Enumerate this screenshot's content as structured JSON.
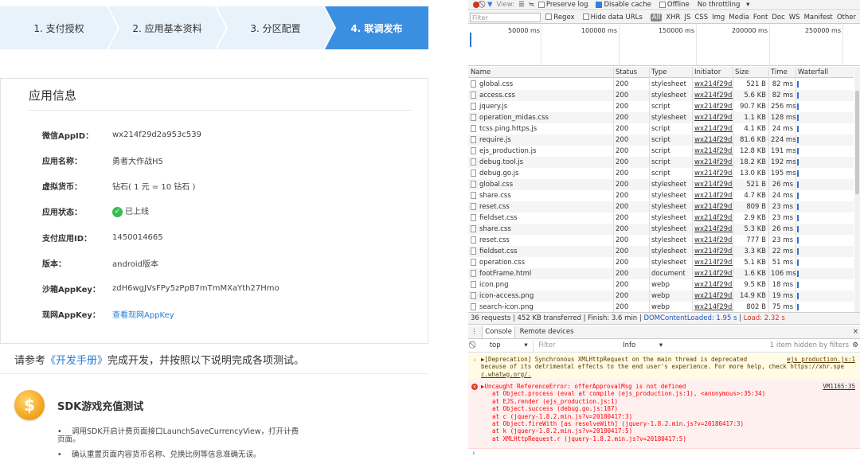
{
  "steps": [
    "1. 支付授权",
    "2. 应用基本资料",
    "3. 分区配置",
    "4. 联调发布"
  ],
  "app_info": {
    "title": "应用信息",
    "rows": [
      {
        "label": "微信AppID：",
        "value": "wx214f29d2a953c539"
      },
      {
        "label": "应用名称：",
        "value": "勇者大作战H5"
      },
      {
        "label": "虚拟货币：",
        "value": "钻石( 1 元 = 10 钻石 )"
      },
      {
        "label": "应用状态：",
        "value": "已上线"
      },
      {
        "label": "支付应用ID：",
        "value": "1450014665"
      },
      {
        "label": "版本：",
        "value": "android版本"
      },
      {
        "label": "沙箱AppKey：",
        "value": "zdH6wgJVsFPy5zPpB7mTmMXaYth27Hmo"
      },
      {
        "label": "现网AppKey：",
        "value": "查看现网AppKey"
      }
    ]
  },
  "note": {
    "prefix": "请参考",
    "link": "《开发手册》",
    "suffix": "完成开发，并按照以下说明完成各项测试。"
  },
  "sdk": {
    "coin": "$",
    "title": "SDK游戏充值测试",
    "bullets": [
      "调用SDK开启计费页面接口LaunchSaveCurrencyView，打开计费页面。",
      "确认重置页面内容货币名称、兑换比例等信息准确无误。"
    ]
  },
  "devtools": {
    "toolbar": {
      "view": "View:",
      "preserve_log": "Preserve log",
      "disable_cache": "Disable cache",
      "offline": "Offline",
      "throttling": "No throttling"
    },
    "filter": {
      "placeholder": "Filter",
      "regex": "Regex",
      "hide_data_urls": "Hide data URLs",
      "all": "All",
      "types": [
        "XHR",
        "JS",
        "CSS",
        "Img",
        "Media",
        "Font",
        "Doc",
        "WS",
        "Manifest",
        "Other"
      ]
    },
    "timeline_ticks": [
      "50000 ms",
      "100000 ms",
      "150000 ms",
      "200000 ms",
      "250000 ms"
    ],
    "columns": [
      "Name",
      "Status",
      "Type",
      "Initiator",
      "Size",
      "Time",
      "Waterfall"
    ],
    "rows": [
      {
        "name": "global.css",
        "status": "200",
        "type": "stylesheet",
        "initiator": "wx214f29d...",
        "size": "521 B",
        "time": "82 ms"
      },
      {
        "name": "access.css",
        "status": "200",
        "type": "stylesheet",
        "initiator": "wx214f29d...",
        "size": "5.6 KB",
        "time": "82 ms"
      },
      {
        "name": "jquery.js",
        "status": "200",
        "type": "script",
        "initiator": "wx214f29d...",
        "size": "90.7 KB",
        "time": "256 ms"
      },
      {
        "name": "operation_midas.css",
        "status": "200",
        "type": "stylesheet",
        "initiator": "wx214f29d...",
        "size": "1.1 KB",
        "time": "128 ms"
      },
      {
        "name": "tcss.ping.https.js",
        "status": "200",
        "type": "script",
        "initiator": "wx214f29d...",
        "size": "4.1 KB",
        "time": "24 ms"
      },
      {
        "name": "require.js",
        "status": "200",
        "type": "script",
        "initiator": "wx214f29d...",
        "size": "81.6 KB",
        "time": "224 ms"
      },
      {
        "name": "ejs_production.js",
        "status": "200",
        "type": "script",
        "initiator": "wx214f29d...",
        "size": "12.8 KB",
        "time": "191 ms"
      },
      {
        "name": "debug.tool.js",
        "status": "200",
        "type": "script",
        "initiator": "wx214f29d...",
        "size": "18.2 KB",
        "time": "192 ms"
      },
      {
        "name": "debug.go.js",
        "status": "200",
        "type": "script",
        "initiator": "wx214f29d...",
        "size": "13.0 KB",
        "time": "195 ms"
      },
      {
        "name": "global.css",
        "status": "200",
        "type": "stylesheet",
        "initiator": "wx214f29d...",
        "size": "521 B",
        "time": "26 ms"
      },
      {
        "name": "share.css",
        "status": "200",
        "type": "stylesheet",
        "initiator": "wx214f29d...",
        "size": "4.7 KB",
        "time": "24 ms"
      },
      {
        "name": "reset.css",
        "status": "200",
        "type": "stylesheet",
        "initiator": "wx214f29d...",
        "size": "809 B",
        "time": "23 ms"
      },
      {
        "name": "fieldset.css",
        "status": "200",
        "type": "stylesheet",
        "initiator": "wx214f29d...",
        "size": "2.9 KB",
        "time": "23 ms"
      },
      {
        "name": "share.css",
        "status": "200",
        "type": "stylesheet",
        "initiator": "wx214f29d...",
        "size": "5.3 KB",
        "time": "26 ms"
      },
      {
        "name": "reset.css",
        "status": "200",
        "type": "stylesheet",
        "initiator": "wx214f29d...",
        "size": "777 B",
        "time": "23 ms"
      },
      {
        "name": "fieldset.css",
        "status": "200",
        "type": "stylesheet",
        "initiator": "wx214f29d...",
        "size": "3.3 KB",
        "time": "22 ms"
      },
      {
        "name": "operation.css",
        "status": "200",
        "type": "stylesheet",
        "initiator": "wx214f29d...",
        "size": "5.1 KB",
        "time": "51 ms"
      },
      {
        "name": "footFrame.html",
        "status": "200",
        "type": "document",
        "initiator": "wx214f29d...",
        "size": "1.6 KB",
        "time": "106 ms"
      },
      {
        "name": "icon.png",
        "status": "200",
        "type": "webp",
        "initiator": "wx214f29d...",
        "size": "9.5 KB",
        "time": "18 ms"
      },
      {
        "name": "icon-access.png",
        "status": "200",
        "type": "webp",
        "initiator": "wx214f29d...",
        "size": "14.9 KB",
        "time": "19 ms"
      },
      {
        "name": "search-icon.png",
        "status": "200",
        "type": "webp",
        "initiator": "wx214f29d...",
        "size": "802 B",
        "time": "75 ms"
      }
    ],
    "status_bar": {
      "summary": "36 requests | 452 KB transferred | Finish: 3.6 min | ",
      "dcl": "DOMContentLoaded: 1.95 s",
      "sep": " | ",
      "load": "Load: 2.32 s"
    },
    "console_tabs": [
      "Console",
      "Remote devices"
    ],
    "console_bar": {
      "context": "top",
      "filter": "Filter",
      "level": "Info",
      "hidden": "1 item hidden by filters"
    },
    "warning": {
      "line1": "▶[Deprecation] Synchronous XMLHttpRequest on the main thread is deprecated",
      "src": "ejs_production.js:1",
      "line2": "because of its detrimental effects to the end user's experience. For more help, check https://xhr.spe",
      "line3": "c.whatwg.org/."
    },
    "error": {
      "line1": "▶Uncaught ReferenceError: offerApprovalMsg is not defined",
      "src": "VM1165:35",
      "stack": [
        "at Object.process (eval at compile (ejs_production.js:1), <anonymous>:35:34)",
        "at EJS.render (ejs_production.js:1)",
        "at Object.success (debug.go.js:187)",
        "at c (jquery-1.8.2.min.js?v=20180417:3)",
        "at Object.fireWith [as resolveWith] (jquery-1.8.2.min.js?v=20180417:3)",
        "at k (jquery-1.8.2.min.js?v=20180417:5)",
        "at XMLHttpRequest.r (jquery-1.8.2.min.js?v=20180417:5)"
      ]
    },
    "prompt": "›"
  }
}
